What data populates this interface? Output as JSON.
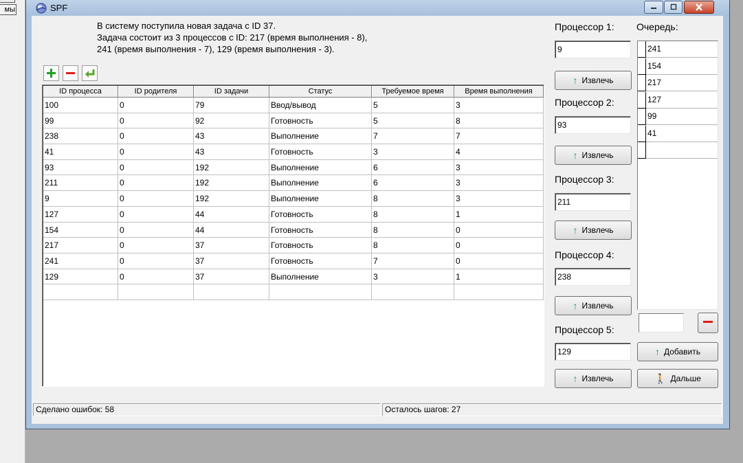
{
  "background_app": {
    "button_text": "мы"
  },
  "window": {
    "title": "SPF",
    "colors": {
      "frame": "#a9c1db",
      "close": "#c7442a"
    }
  },
  "message": {
    "line1": "В систему поступила новая задача с ID 37.",
    "line2": "Задача состоит из 3 процессов с ID: 217 (время выполнения - 8),",
    "line3": "241 (время выполнения - 7), 129 (время выполнения - 3)."
  },
  "toolbar": {
    "add_icon": "plus-icon",
    "remove_icon": "minus-icon",
    "accept_icon": "enter-arrow-icon"
  },
  "table": {
    "columns": [
      "ID процесса",
      "ID родителя",
      "ID задачи",
      "Статус",
      "Требуемое время",
      "Время выполнения"
    ],
    "rows": [
      [
        "100",
        "0",
        "79",
        "Ввод/вывод",
        "5",
        "3"
      ],
      [
        "99",
        "0",
        "92",
        "Готовность",
        "5",
        "8"
      ],
      [
        "238",
        "0",
        "43",
        "Выполнение",
        "7",
        "7"
      ],
      [
        "41",
        "0",
        "43",
        "Готовность",
        "3",
        "4"
      ],
      [
        "93",
        "0",
        "192",
        "Выполнение",
        "6",
        "3"
      ],
      [
        "211",
        "0",
        "192",
        "Выполнение",
        "6",
        "3"
      ],
      [
        "9",
        "0",
        "192",
        "Выполнение",
        "8",
        "3"
      ],
      [
        "127",
        "0",
        "44",
        "Готовность",
        "8",
        "1"
      ],
      [
        "154",
        "0",
        "44",
        "Готовность",
        "8",
        "0"
      ],
      [
        "217",
        "0",
        "37",
        "Готовность",
        "8",
        "0"
      ],
      [
        "241",
        "0",
        "37",
        "Готовность",
        "7",
        "0"
      ],
      [
        "129",
        "0",
        "37",
        "Выполнение",
        "3",
        "1"
      ],
      [
        "",
        "",
        "",
        "",
        "",
        ""
      ]
    ]
  },
  "processors": [
    {
      "label": "Процессор 1:",
      "value": "9",
      "button": "Извлечь"
    },
    {
      "label": "Процессор 2:",
      "value": "93",
      "button": "Извлечь"
    },
    {
      "label": "Процессор 3:",
      "value": "211",
      "button": "Извлечь"
    },
    {
      "label": "Процессор 4:",
      "value": "238",
      "button": "Извлечь"
    },
    {
      "label": "Процессор 5:",
      "value": "129",
      "button": "Извлечь"
    }
  ],
  "queue": {
    "label": "Очередь:",
    "items": [
      "241",
      "154",
      "217",
      "127",
      "99",
      "41",
      ""
    ],
    "input_value": "",
    "add_label": "Добавить",
    "next_label": "Дальше"
  },
  "status": {
    "errors": "Сделано ошибок: 58",
    "steps": "Осталось шагов: 27"
  }
}
